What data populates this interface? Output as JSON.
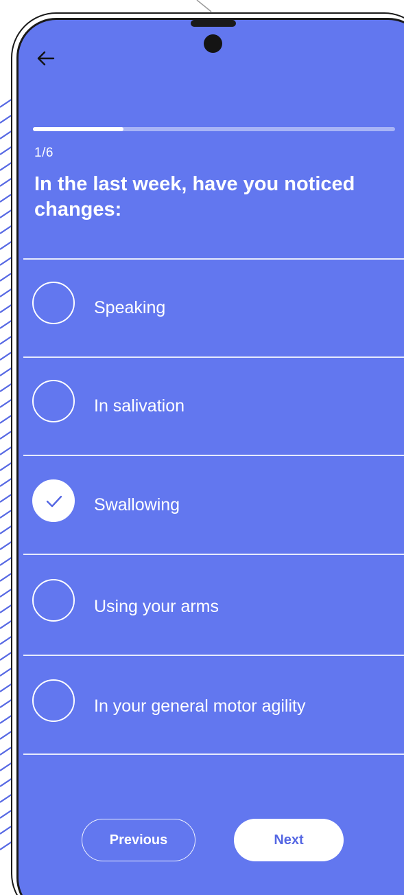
{
  "colors": {
    "screen_background": "#6277ef",
    "accent": "#5567e3",
    "foreground": "#ffffff",
    "frame": "#1a1a1a"
  },
  "header": {
    "back_icon": "arrow-left-icon"
  },
  "progress": {
    "fraction": 0.25
  },
  "question": {
    "counter": "1/6",
    "text": "In the last week, have you noticed changes:"
  },
  "options": [
    {
      "label": "Speaking",
      "checked": false
    },
    {
      "label": "In salivation",
      "checked": false
    },
    {
      "label": "Swallowing",
      "checked": true
    },
    {
      "label": "Using your arms",
      "checked": false
    },
    {
      "label": "In your general motor agility",
      "checked": false
    }
  ],
  "footer": {
    "previous_label": "Previous",
    "next_label": "Next"
  }
}
